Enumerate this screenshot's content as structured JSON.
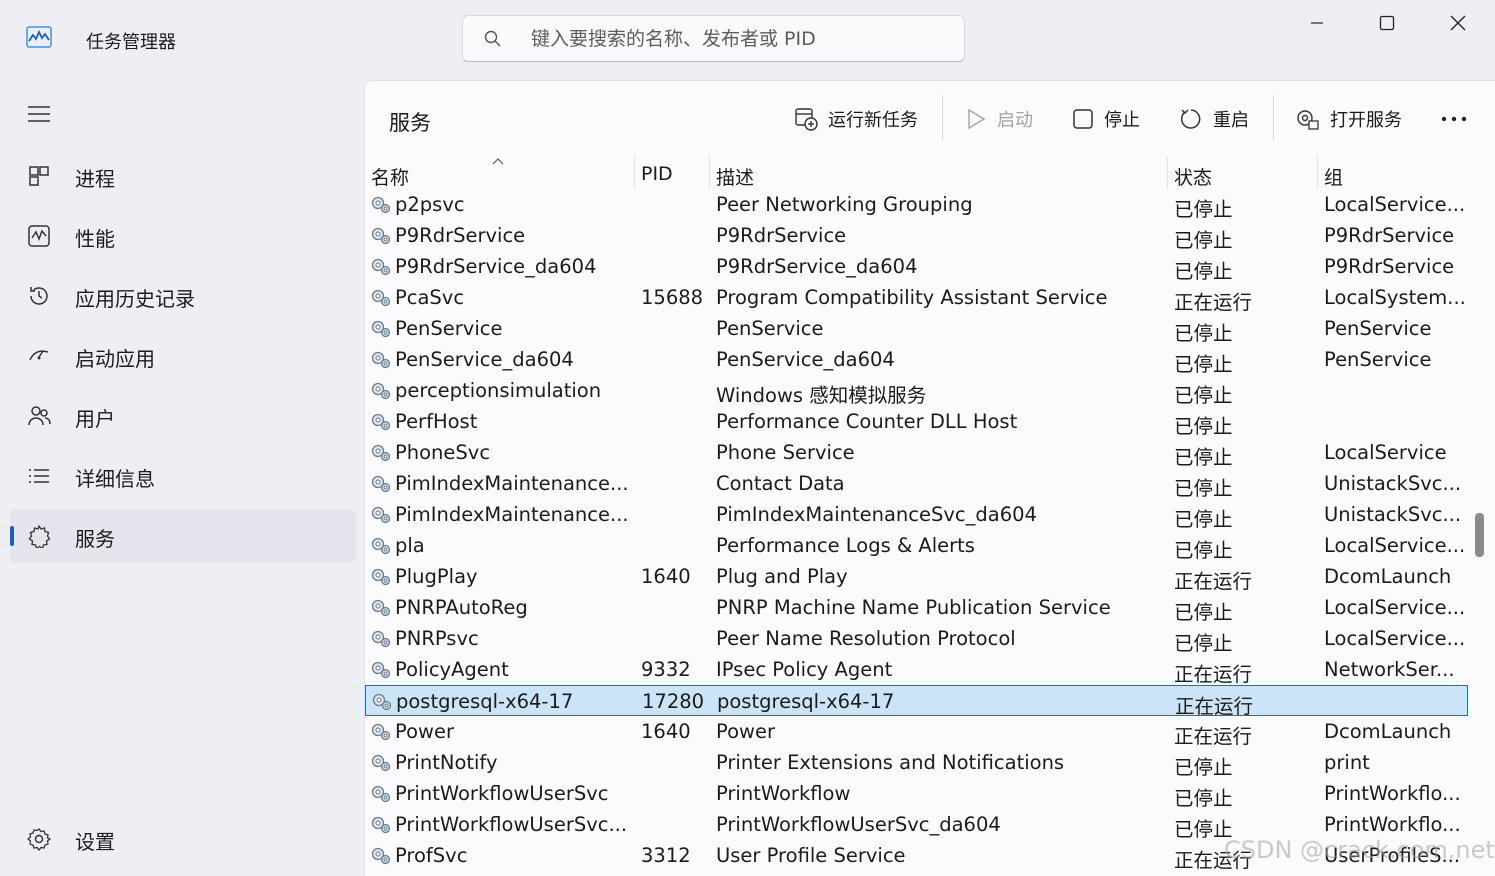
{
  "app": {
    "title": "任务管理器"
  },
  "search": {
    "placeholder": "键入要搜索的名称、发布者或 PID"
  },
  "sidebar": {
    "items": [
      {
        "label": "进程",
        "icon": "processes-icon"
      },
      {
        "label": "性能",
        "icon": "performance-icon"
      },
      {
        "label": "应用历史记录",
        "icon": "history-icon"
      },
      {
        "label": "启动应用",
        "icon": "startup-icon"
      },
      {
        "label": "用户",
        "icon": "users-icon"
      },
      {
        "label": "详细信息",
        "icon": "details-icon"
      },
      {
        "label": "服务",
        "icon": "services-icon",
        "active": true
      }
    ],
    "settings_label": "设置"
  },
  "page": {
    "title": "服务"
  },
  "toolbar": {
    "run_new_task": "运行新任务",
    "start": "启动",
    "stop": "停止",
    "restart": "重启",
    "open_services": "打开服务"
  },
  "table": {
    "columns": [
      "名称",
      "PID",
      "描述",
      "状态",
      "组"
    ],
    "rows": [
      {
        "name": "p2psvc",
        "pid": "",
        "desc": "Peer Networking Grouping",
        "status": "已停止",
        "group": "LocalService..."
      },
      {
        "name": "P9RdrService",
        "pid": "",
        "desc": "P9RdrService",
        "status": "已停止",
        "group": "P9RdrService"
      },
      {
        "name": "P9RdrService_da604",
        "pid": "",
        "desc": "P9RdrService_da604",
        "status": "已停止",
        "group": "P9RdrService"
      },
      {
        "name": "PcaSvc",
        "pid": "15688",
        "desc": "Program Compatibility Assistant Service",
        "status": "正在运行",
        "group": "LocalSystem..."
      },
      {
        "name": "PenService",
        "pid": "",
        "desc": "PenService",
        "status": "已停止",
        "group": "PenService"
      },
      {
        "name": "PenService_da604",
        "pid": "",
        "desc": "PenService_da604",
        "status": "已停止",
        "group": "PenService"
      },
      {
        "name": "perceptionsimulation",
        "pid": "",
        "desc": "Windows 感知模拟服务",
        "status": "已停止",
        "group": ""
      },
      {
        "name": "PerfHost",
        "pid": "",
        "desc": "Performance Counter DLL Host",
        "status": "已停止",
        "group": ""
      },
      {
        "name": "PhoneSvc",
        "pid": "",
        "desc": "Phone Service",
        "status": "已停止",
        "group": "LocalService"
      },
      {
        "name": "PimIndexMaintenance...",
        "pid": "",
        "desc": "Contact Data",
        "status": "已停止",
        "group": "UnistackSvc..."
      },
      {
        "name": "PimIndexMaintenance...",
        "pid": "",
        "desc": "PimIndexMaintenanceSvc_da604",
        "status": "已停止",
        "group": "UnistackSvc..."
      },
      {
        "name": "pla",
        "pid": "",
        "desc": "Performance Logs & Alerts",
        "status": "已停止",
        "group": "LocalService..."
      },
      {
        "name": "PlugPlay",
        "pid": "1640",
        "desc": "Plug and Play",
        "status": "正在运行",
        "group": "DcomLaunch"
      },
      {
        "name": "PNRPAutoReg",
        "pid": "",
        "desc": "PNRP Machine Name Publication Service",
        "status": "已停止",
        "group": "LocalService..."
      },
      {
        "name": "PNRPsvc",
        "pid": "",
        "desc": "Peer Name Resolution Protocol",
        "status": "已停止",
        "group": "LocalService..."
      },
      {
        "name": "PolicyAgent",
        "pid": "9332",
        "desc": "IPsec Policy Agent",
        "status": "正在运行",
        "group": "NetworkSer..."
      },
      {
        "name": "postgresql-x64-17",
        "pid": "17280",
        "desc": "postgresql-x64-17",
        "status": "正在运行",
        "group": "",
        "selected": true
      },
      {
        "name": "Power",
        "pid": "1640",
        "desc": "Power",
        "status": "正在运行",
        "group": "DcomLaunch"
      },
      {
        "name": "PrintNotify",
        "pid": "",
        "desc": "Printer Extensions and Notifications",
        "status": "已停止",
        "group": "print"
      },
      {
        "name": "PrintWorkflowUserSvc",
        "pid": "",
        "desc": "PrintWorkflow",
        "status": "已停止",
        "group": "PrintWorkflo..."
      },
      {
        "name": "PrintWorkflowUserSvc...",
        "pid": "",
        "desc": "PrintWorkflowUserSvc_da604",
        "status": "已停止",
        "group": "PrintWorkflo..."
      },
      {
        "name": "ProfSvc",
        "pid": "3312",
        "desc": "User Profile Service",
        "status": "正在运行",
        "group": "UserProfileS..."
      }
    ]
  },
  "watermark": "CSDN @crack.com.net",
  "colors": {
    "accent": "#1a5fb4",
    "selected_row": "#cce4f7",
    "selected_border": "#0078d4"
  }
}
